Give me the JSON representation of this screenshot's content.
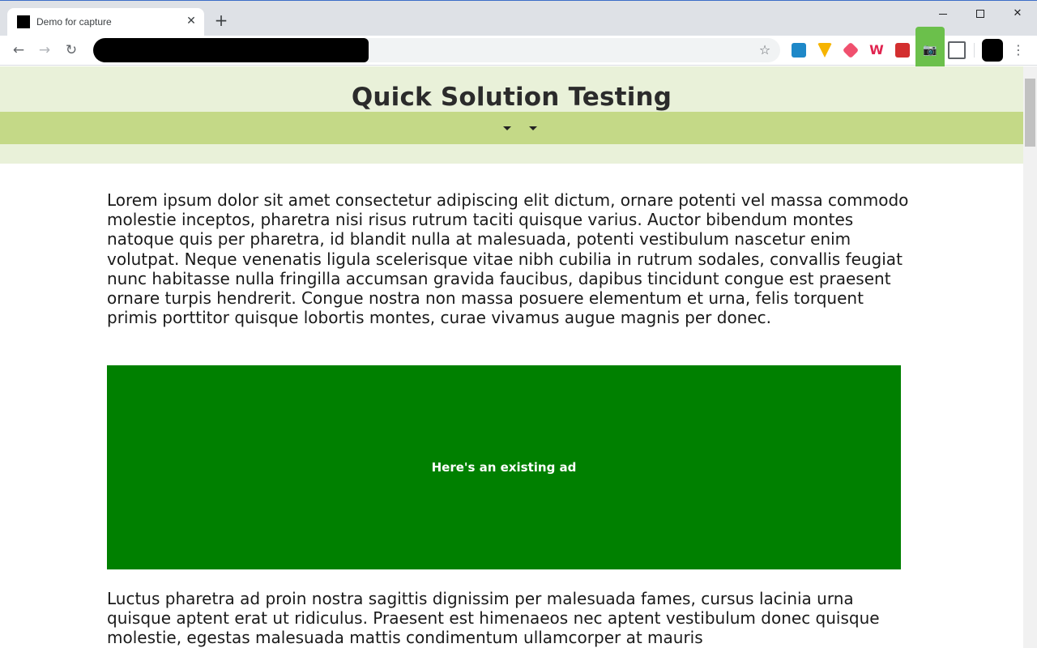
{
  "browser": {
    "tab_title": "Demo for capture",
    "tab_close": "✕",
    "new_tab": "+",
    "window_close": "✕",
    "back": "←",
    "forward": "→",
    "reload": "↻",
    "bookmark_star": "☆",
    "menu": "⋮",
    "extension_w": "W",
    "camera": "📷"
  },
  "page": {
    "title": "Quick Solution Testing",
    "paragraph1": "Lorem ipsum dolor sit amet consectetur adipiscing elit dictum, ornare potenti vel massa commodo molestie inceptos, pharetra nisi risus rutrum taciti quisque varius. Auctor bibendum montes natoque quis per pharetra, id blandit nulla at malesuada, potenti vestibulum nascetur enim volutpat. Neque venenatis ligula scelerisque vitae nibh cubilia in rutrum sodales, convallis feugiat nunc habitasse nulla fringilla accumsan gravida faucibus, dapibus tincidunt congue est praesent ornare turpis hendrerit. Congue nostra non massa posuere elementum et urna, felis torquent primis porttitor quisque lobortis montes, curae vivamus augue magnis per donec.",
    "ad_text": "Here's an existing ad",
    "paragraph2": "Luctus pharetra ad proin nostra sagittis dignissim per malesuada fames, cursus lacinia urna quisque aptent erat ut ridiculus. Praesent est himenaeos nec aptent vestibulum donec quisque molestie, egestas malesuada mattis condimentum ullamcorper at mauris"
  },
  "colors": {
    "hero_bg": "#e9f1d9",
    "nav_band": "#c4d987",
    "ad_bg": "#008000",
    "camera_ext": "#6bc04b"
  }
}
